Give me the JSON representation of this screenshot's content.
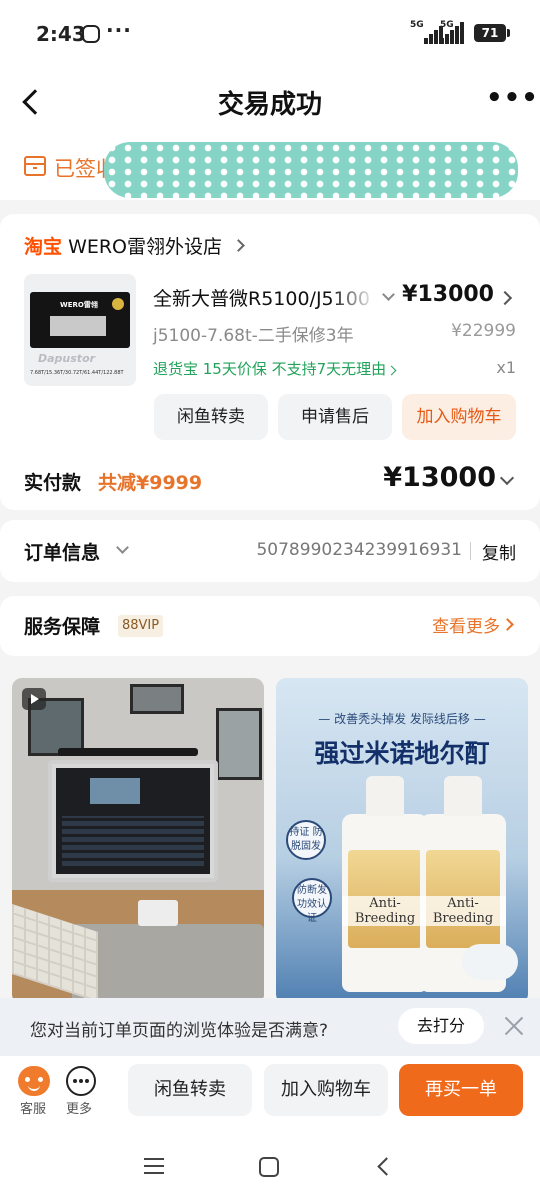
{
  "status_bar": {
    "time": "2:43",
    "more": "···",
    "network_1": "5G",
    "network_2": "5G",
    "battery": "71"
  },
  "header": {
    "title": "交易成功"
  },
  "delivery": {
    "status_text": "已签收"
  },
  "shop": {
    "platform": "淘宝",
    "name": "WERO雷翎外设店"
  },
  "product": {
    "image_brand": "WERO雷翎",
    "image_model": "Dapustor",
    "image_spec": "7.68T/15.36T/30.72T/61.44T/122.88T",
    "title": "全新大普微R5100/J5100",
    "price": "¥13000",
    "spec": "j5100-7.68t-二手保修3年",
    "original_price": "¥22999",
    "tags": "退货宝  15天价保  不支持7天无理由",
    "quantity": "x1"
  },
  "actions": {
    "xianyu_sell": "闲鱼转卖",
    "after_sale": "申请售后",
    "add_cart": "加入购物车"
  },
  "payment": {
    "label": "实付款",
    "discount": "共减¥9999",
    "total": "¥13000"
  },
  "order": {
    "label": "订单信息",
    "number": "5078990234239916931",
    "copy": "复制"
  },
  "service": {
    "label": "服务保障",
    "vip": "88VIP",
    "see_more": "查看更多"
  },
  "feed": {
    "ad_tagline": "— 改善秃头掉发 发际线后移 —",
    "ad_headline": "强过米诺地尔酊",
    "ad_badge_1": "持证 防脱固发",
    "ad_badge_2": "防断发 功效认证",
    "ad_product_label": "Anti-Breeding"
  },
  "survey": {
    "question": "您对当前订单页面的浏览体验是否满意?",
    "rate_button": "去打分"
  },
  "bottom_bar": {
    "customer_service": "客服",
    "more": "更多",
    "xianyu_sell": "闲鱼转卖",
    "add_cart": "加入购物车",
    "buy_again": "再买一单"
  },
  "colors": {
    "accent": "#e8742b",
    "primary_button": "#f06a1c",
    "success_green": "#22a35a",
    "taobao_orange": "#ff5000"
  }
}
